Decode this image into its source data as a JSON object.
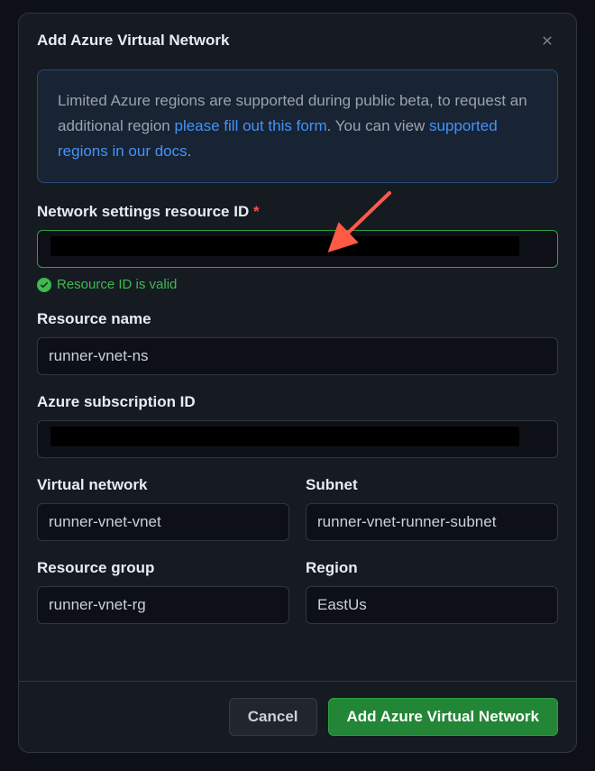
{
  "modal": {
    "title": "Add Azure Virtual Network"
  },
  "banner": {
    "text1": "Limited Azure regions are supported during public beta, to request an additional region ",
    "link1": "please fill out this form",
    "text2": ". You can view ",
    "link2": "supported regions in our docs",
    "text3": "."
  },
  "fields": {
    "resource_id": {
      "label": "Network settings resource ID ",
      "required": "*",
      "validation": "Resource ID is valid"
    },
    "resource_name": {
      "label": "Resource name",
      "value": "runner-vnet-ns"
    },
    "subscription_id": {
      "label": "Azure subscription ID"
    },
    "virtual_network": {
      "label": "Virtual network",
      "value": "runner-vnet-vnet"
    },
    "subnet": {
      "label": "Subnet",
      "value": "runner-vnet-runner-subnet"
    },
    "resource_group": {
      "label": "Resource group",
      "value": "runner-vnet-rg"
    },
    "region": {
      "label": "Region",
      "value": "EastUs"
    }
  },
  "footer": {
    "cancel": "Cancel",
    "submit": "Add Azure Virtual Network"
  }
}
